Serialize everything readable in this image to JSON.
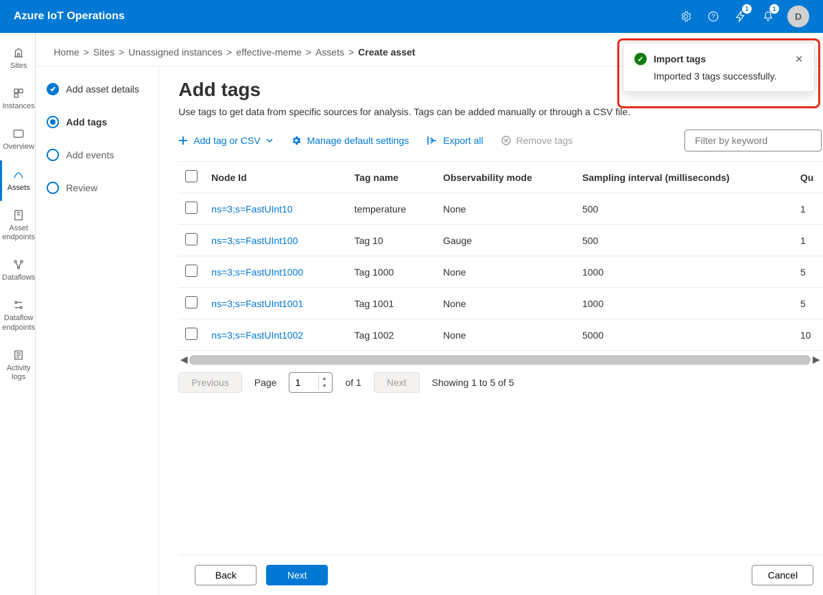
{
  "header": {
    "app_title": "Azure IoT Operations",
    "lightning_badge": "1",
    "bell_badge": "1",
    "avatar_initial": "D"
  },
  "breadcrumb": {
    "items": [
      "Home",
      "Sites",
      "Unassigned instances",
      "effective-meme",
      "Assets",
      "Create asset"
    ]
  },
  "sidenav": {
    "items": [
      {
        "label": "Sites"
      },
      {
        "label": "Instances"
      },
      {
        "label": "Overview"
      },
      {
        "label": "Assets"
      },
      {
        "label": "Asset endpoints"
      },
      {
        "label": "Dataflows"
      },
      {
        "label": "Dataflow endpoints"
      },
      {
        "label": "Activity logs"
      }
    ],
    "active_index": 3
  },
  "stepper": {
    "steps": [
      {
        "label": "Add asset details",
        "state": "done"
      },
      {
        "label": "Add tags",
        "state": "active"
      },
      {
        "label": "Add events",
        "state": "todo"
      },
      {
        "label": "Review",
        "state": "todo"
      }
    ]
  },
  "page": {
    "title": "Add tags",
    "description": "Use tags to get data from specific sources for analysis. Tags can be added manually or through a CSV file."
  },
  "toolbar": {
    "add_tag": "Add tag or CSV",
    "manage": "Manage default settings",
    "export": "Export all",
    "remove": "Remove tags",
    "filter_placeholder": "Filter by keyword"
  },
  "table": {
    "columns": [
      "Node Id",
      "Tag name",
      "Observability mode",
      "Sampling interval (milliseconds)",
      "Qu"
    ],
    "rows": [
      {
        "node_id": "ns=3;s=FastUInt10",
        "tag_name": "temperature",
        "mode": "None",
        "interval": "500",
        "qu": "1"
      },
      {
        "node_id": "ns=3;s=FastUInt100",
        "tag_name": "Tag 10",
        "mode": "Gauge",
        "interval": "500",
        "qu": "1"
      },
      {
        "node_id": "ns=3;s=FastUInt1000",
        "tag_name": "Tag 1000",
        "mode": "None",
        "interval": "1000",
        "qu": "5"
      },
      {
        "node_id": "ns=3;s=FastUInt1001",
        "tag_name": "Tag 1001",
        "mode": "None",
        "interval": "1000",
        "qu": "5"
      },
      {
        "node_id": "ns=3;s=FastUInt1002",
        "tag_name": "Tag 1002",
        "mode": "None",
        "interval": "5000",
        "qu": "10"
      }
    ]
  },
  "pager": {
    "prev": "Previous",
    "page_label": "Page",
    "page_value": "1",
    "of": "of 1",
    "next": "Next",
    "showing": "Showing 1 to 5 of 5"
  },
  "footer": {
    "back": "Back",
    "next": "Next",
    "cancel": "Cancel"
  },
  "toast": {
    "title": "Import tags",
    "message": "Imported 3 tags successfully."
  }
}
